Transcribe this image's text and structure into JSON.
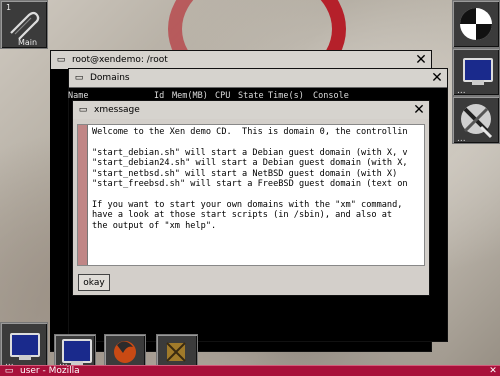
{
  "desktop": {
    "dock_top_left": {
      "number": "1",
      "label": "Main",
      "icon": "paperclip-icon"
    },
    "dock_right": [
      {
        "icon": "workspace-clip-icon"
      },
      {
        "icon": "monitor-icon",
        "dots": "..."
      },
      {
        "icon": "tools-icon",
        "dots": "..."
      }
    ],
    "dock_bottom": [
      {
        "icon": "monitor-icon",
        "dots": "..."
      },
      {
        "icon": "monitor-icon",
        "dots": "..."
      },
      {
        "icon": "mozilla-icon"
      },
      {
        "icon": "app-icon"
      }
    ]
  },
  "terminal_window": {
    "title": "root@xendemo: /root"
  },
  "domains_window": {
    "title": "Domains",
    "columns": [
      "Name",
      "Id",
      "Mem(MB)",
      "CPU",
      "State",
      "Time(s)",
      "Console"
    ]
  },
  "xmessage_window": {
    "title": "xmessage",
    "message": "Welcome to the Xen demo CD.  This is domain 0, the controllin\n\n\"start_debian.sh\" will start a Debian guest domain (with X, v\n\"start_debian24.sh\" will start a Debian guest domain (with X,\n\"start_netbsd.sh\" will start a NetBSD guest domain (with X)\n\"start_freebsd.sh\" will start a FreeBSD guest domain (text on\n\nIf you want to start your own domains with the \"xm\" command,\nhave a look at those start scripts (in /sbin), and also at\nthe output of \"xm help\".",
    "okay_label": "okay"
  },
  "taskbar": {
    "title": "user - Mozilla"
  },
  "colors": {
    "taskbar": "#a8103a",
    "titlebar": "#d6d3ce",
    "xmessage_bar": "#c08686"
  }
}
